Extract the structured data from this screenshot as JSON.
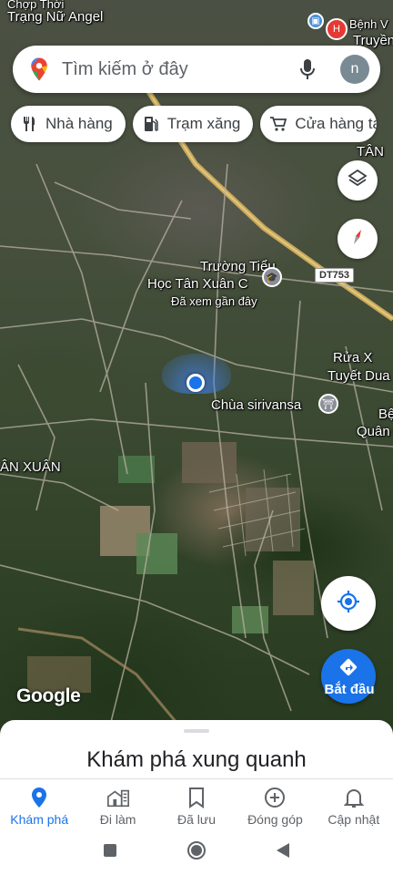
{
  "map": {
    "labels": {
      "top_left_1": "Chợp Thời",
      "top_left_2": "Trạng Nữ Angel",
      "top_right_1": "Bệnh V",
      "top_right_2": "Truyền",
      "tan_top_right": "TÂN",
      "school_line1": "Trường Tiểu",
      "school_line2": "Học Tân Xuân C",
      "school_sub": "Đã xem gần đây",
      "road_shield": "DT753",
      "rua_line1": "Rửa X",
      "rua_line2": "Tuyết Dua",
      "pagoda": "Chùa sirivansa",
      "be_line1": "Bệ",
      "be_line2": "Quân Đ",
      "tan_xuan": "ÂN XUÂN"
    },
    "logo_text": "Google"
  },
  "search": {
    "placeholder": "Tìm kiếm ở đây",
    "avatar_letter": "n"
  },
  "chips": [
    {
      "label": "Nhà hàng",
      "icon": "fork-knife-icon"
    },
    {
      "label": "Trạm xăng",
      "icon": "gas-station-icon"
    },
    {
      "label": "Cửa hàng tạp",
      "icon": "shopping-cart-icon"
    }
  ],
  "start_button": {
    "label": "Bắt đầu"
  },
  "sheet": {
    "title": "Khám phá xung quanh"
  },
  "nav": [
    {
      "label": "Khám phá",
      "icon": "explore-pin-icon",
      "active": true
    },
    {
      "label": "Đi làm",
      "icon": "commute-icon",
      "active": false
    },
    {
      "label": "Đã lưu",
      "icon": "bookmark-icon",
      "active": false
    },
    {
      "label": "Đóng góp",
      "icon": "add-circle-icon",
      "active": false
    },
    {
      "label": "Cập nhật",
      "icon": "bell-icon",
      "active": false
    }
  ],
  "colors": {
    "accent": "#1a73e8",
    "text_secondary": "#5f6368"
  }
}
